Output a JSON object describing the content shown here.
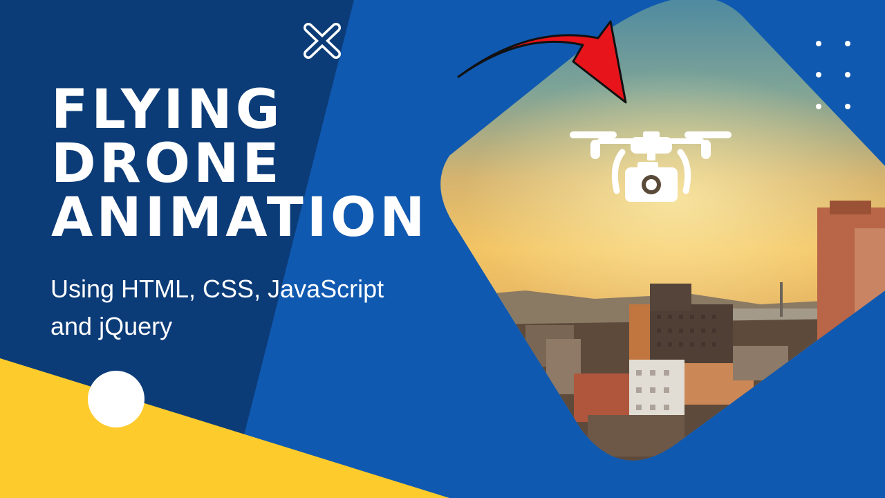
{
  "thumbnail": {
    "title_lines": [
      "FLYING",
      "DRONE",
      "ANIMATION"
    ],
    "subtitle_lines": [
      "Using HTML, CSS, JavaScript",
      "and jQuery"
    ]
  },
  "icons": {
    "cross": "close-cross-icon",
    "arrow": "curved-arrow-icon",
    "drone": "camera-drone-icon",
    "dots": "dot-grid-icon"
  },
  "colors": {
    "navy": "#0c3c78",
    "blue": "#1059b0",
    "yellow": "#fdcb2b",
    "arrow_red": "#e8141b",
    "white": "#ffffff"
  }
}
